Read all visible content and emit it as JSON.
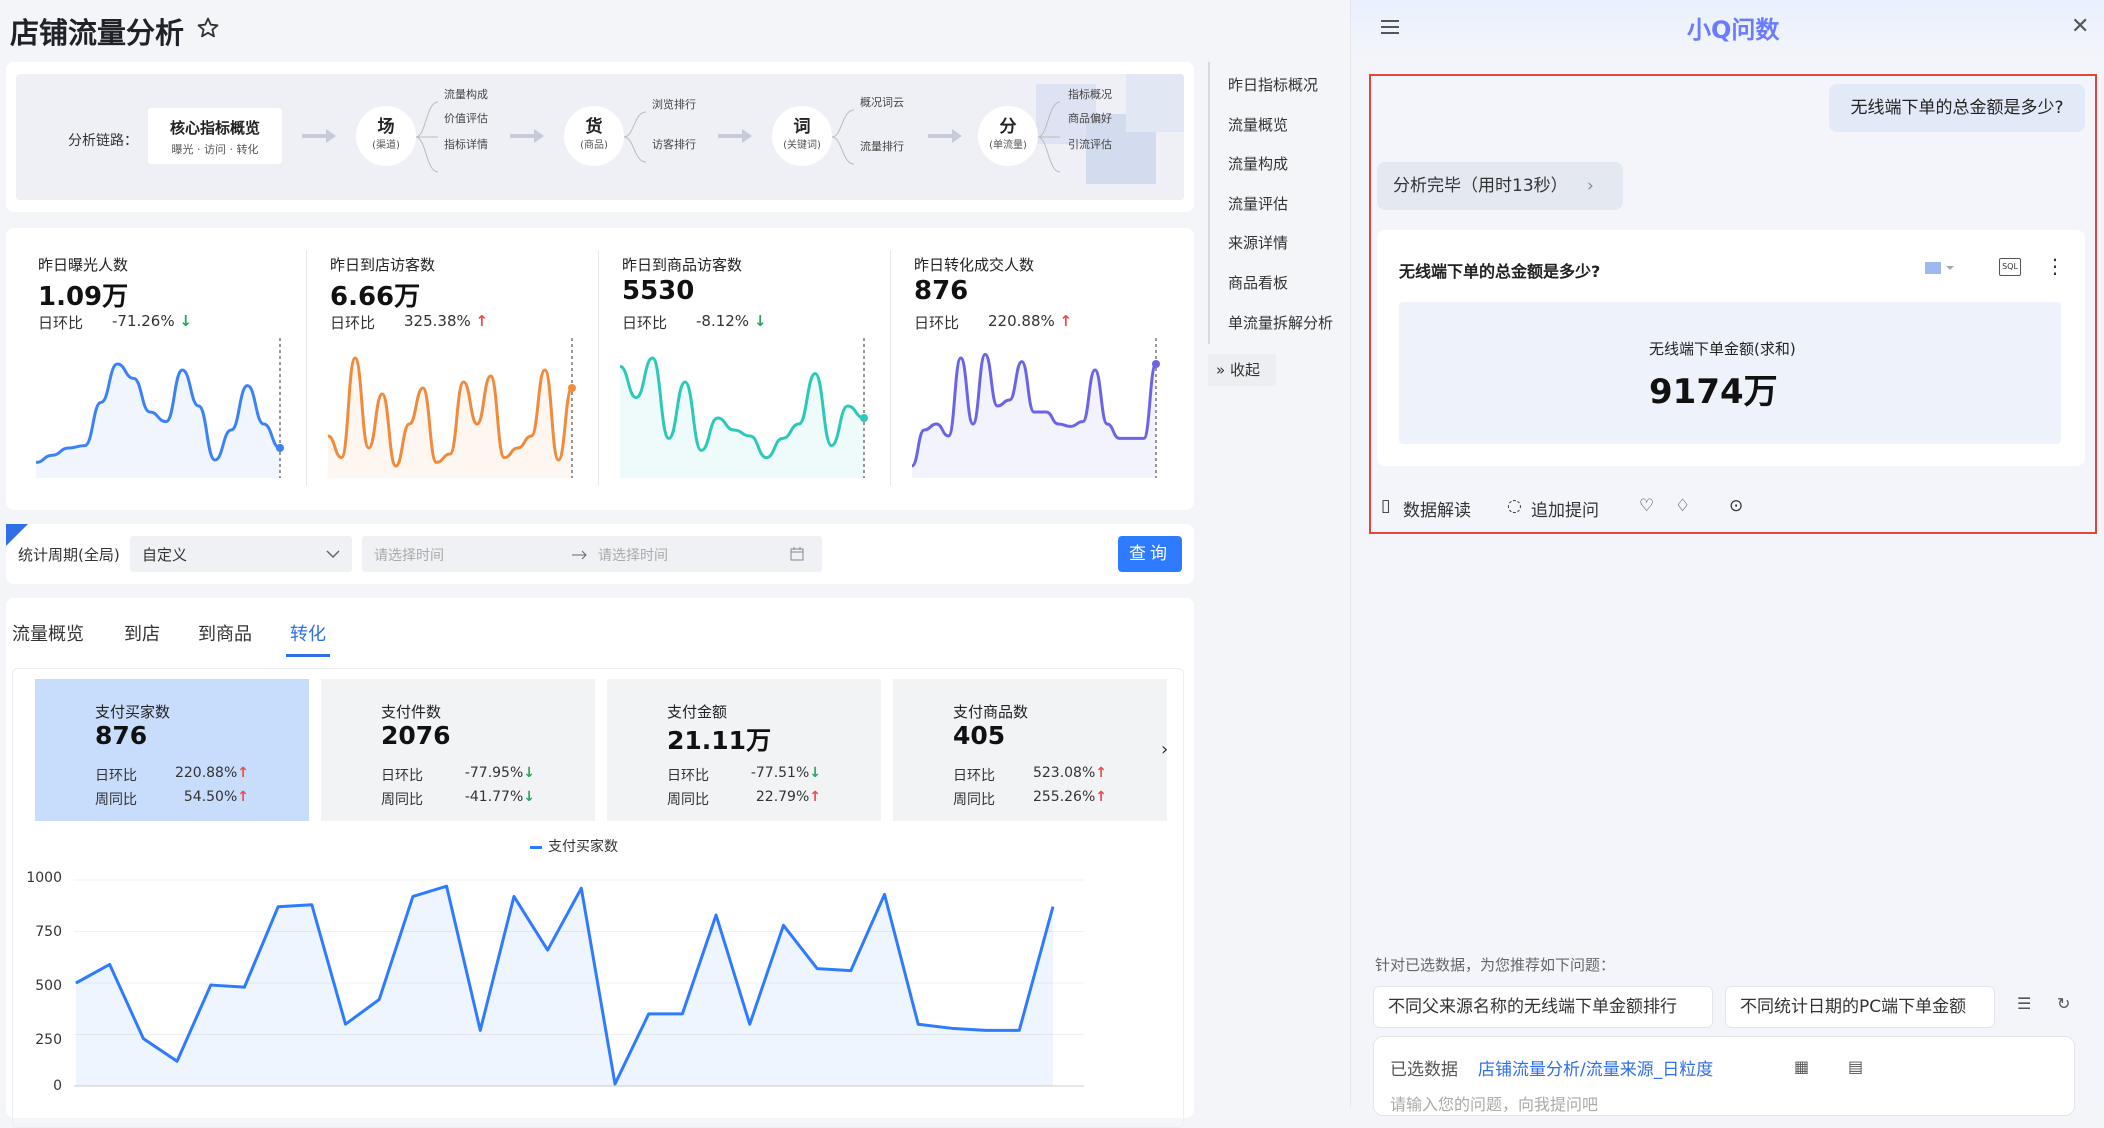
{
  "page": {
    "title": "店铺流量分析"
  },
  "chain": {
    "label": "分析链路：",
    "core_title": "核心指标概览",
    "core_sub": "曝光 · 访问 · 转化",
    "nodes": [
      {
        "title": "场",
        "sub": "(渠道)",
        "items": [
          "流量构成",
          "价值评估",
          "指标详情"
        ]
      },
      {
        "title": "货",
        "sub": "(商品)",
        "items": [
          "浏览排行",
          "访客排行"
        ]
      },
      {
        "title": "词",
        "sub": "(关键词)",
        "items": [
          "概况词云",
          "流量排行"
        ]
      },
      {
        "title": "分",
        "sub": "(单流量)",
        "items": [
          "指标概况",
          "商品偏好",
          "引流评估"
        ]
      }
    ]
  },
  "metrics": [
    {
      "name": "昨日曝光人数",
      "value": "1.09万",
      "cmp_label": "日环比",
      "cmp": "-71.26%",
      "dir": "down",
      "color": "#3b82f6",
      "series": [
        8,
        14,
        20,
        22,
        58,
        90,
        78,
        50,
        42,
        85,
        55,
        10,
        35,
        72,
        40,
        20
      ]
    },
    {
      "name": "昨日到店访客数",
      "value": "6.66万",
      "cmp_label": "日环比",
      "cmp": "325.38%",
      "dir": "up",
      "color": "#f08a3c",
      "series": [
        30,
        12,
        95,
        20,
        65,
        5,
        40,
        70,
        8,
        15,
        75,
        40,
        80,
        12,
        20,
        30,
        85,
        10,
        70
      ]
    },
    {
      "name": "昨日到商品访客数",
      "value": "5530",
      "cmp_label": "日环比",
      "cmp": "-8.12%",
      "dir": "down",
      "color": "#2bc9b9",
      "series": [
        88,
        62,
        95,
        28,
        75,
        18,
        45,
        35,
        30,
        12,
        28,
        40,
        82,
        22,
        55,
        45
      ]
    },
    {
      "name": "昨日转化成交人数",
      "value": "876",
      "cmp_label": "日环比",
      "cmp": "220.88%",
      "dir": "up",
      "color": "#6b65e6",
      "series": [
        5,
        35,
        40,
        30,
        95,
        40,
        98,
        55,
        60,
        92,
        50,
        50,
        40,
        38,
        42,
        85,
        40,
        28,
        28,
        28,
        90
      ]
    }
  ],
  "filter": {
    "label": "统计周期(全局)",
    "select_value": "自定义",
    "start_placeholder": "请选择时间",
    "end_placeholder": "请选择时间",
    "query_label": "查询"
  },
  "tabs": [
    {
      "label": "流量概览",
      "active": false
    },
    {
      "label": "到店",
      "active": false
    },
    {
      "label": "到商品",
      "active": false
    },
    {
      "label": "转化",
      "active": true
    }
  ],
  "kpis": [
    {
      "name": "支付买家数",
      "value": "876",
      "r1_label": "日环比",
      "r1": "220.88%",
      "r1_dir": "up",
      "r2_label": "周同比",
      "r2": "54.50%",
      "r2_dir": "up",
      "active": true
    },
    {
      "name": "支付件数",
      "value": "2076",
      "r1_label": "日环比",
      "r1": "-77.95%",
      "r1_dir": "down",
      "r2_label": "周同比",
      "r2": "-41.77%",
      "r2_dir": "down",
      "active": false
    },
    {
      "name": "支付金额",
      "value": "21.11万",
      "r1_label": "日环比",
      "r1": "-77.51%",
      "r1_dir": "down",
      "r2_label": "周同比",
      "r2": "22.79%",
      "r2_dir": "up",
      "active": false
    },
    {
      "name": "支付商品数",
      "value": "405",
      "r1_label": "日环比",
      "r1": "523.08%",
      "r1_dir": "up",
      "r2_label": "周同比",
      "r2": "255.26%",
      "r2_dir": "up",
      "active": false
    }
  ],
  "chart_data": {
    "type": "area",
    "legend": "支付买家数",
    "yticks": [
      "1000",
      "750",
      "500",
      "250",
      "0"
    ],
    "ylim": [
      0,
      1000
    ],
    "values": [
      500,
      590,
      230,
      120,
      490,
      480,
      870,
      880,
      300,
      420,
      920,
      970,
      270,
      920,
      660,
      960,
      10,
      350,
      350,
      830,
      300,
      780,
      570,
      560,
      930,
      300,
      280,
      270,
      270,
      870
    ]
  },
  "anchor": {
    "items": [
      "昨日指标概况",
      "流量概览",
      "流量构成",
      "流量评估",
      "来源详情",
      "商品看板",
      "单流量拆解分析"
    ],
    "collapse": "收起"
  },
  "assistant": {
    "brand": "小Q问数",
    "user_question": "无线端下单的总金额是多少?",
    "status": "分析完毕（用时13秒）",
    "answer_title": "无线端下单的总金额是多少?",
    "sql_label": "SQL",
    "answer_metric_name": "无线端下单金额(求和)",
    "answer_metric_value": "9174万",
    "actions": [
      "数据解读",
      "追加提问"
    ],
    "suggest_title": "针对已选数据，为您推荐如下问题：",
    "suggestions": [
      "不同父来源名称的无线端下单金额排行",
      "不同统计日期的PC端下单金额"
    ],
    "selected_label": "已选数据",
    "selected_value": "店铺流量分析/流量来源_日粒度",
    "input_placeholder": "请输入您的问题，向我提问吧"
  }
}
